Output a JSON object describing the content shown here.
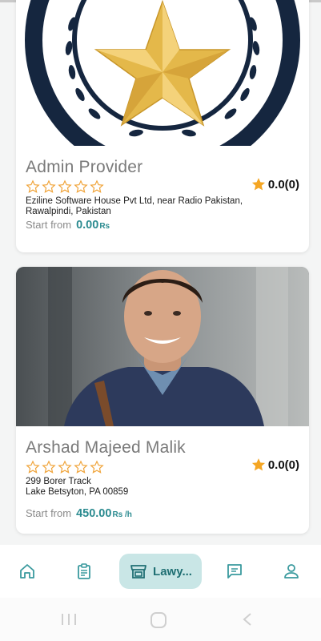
{
  "cards": [
    {
      "name": "Admin Provider",
      "stars": 0,
      "rating": "0.0(0)",
      "address_lines": [
        "Eziline Software House Pvt Ltd, near Radio Pakistan,",
        "Rawalpindi, Pakistan"
      ],
      "price_label": "Start from",
      "price_value": "0.00",
      "price_unit": "Rs"
    },
    {
      "name": "Arshad Majeed Malik",
      "stars": 0,
      "rating": "0.0(0)",
      "address_lines": [
        "299 Borer Track",
        "Lake Betsyton, PA 00859"
      ],
      "price_label": "Start from",
      "price_value": "450.00",
      "price_unit": "Rs /h"
    }
  ],
  "nav": {
    "items": [
      {
        "icon": "home-icon"
      },
      {
        "icon": "clipboard-icon"
      },
      {
        "icon": "store-icon",
        "label": "Lawy...",
        "active": true
      },
      {
        "icon": "chat-icon"
      },
      {
        "icon": "person-icon"
      }
    ]
  },
  "colors": {
    "accent": "#2b8b90",
    "nav_active_bg": "#c9e6e6",
    "star_outline": "#f0a43a",
    "star_fill": "#f5a623"
  },
  "system_nav": {
    "icons": [
      "recents-icon",
      "home-circle-icon",
      "back-icon"
    ]
  }
}
